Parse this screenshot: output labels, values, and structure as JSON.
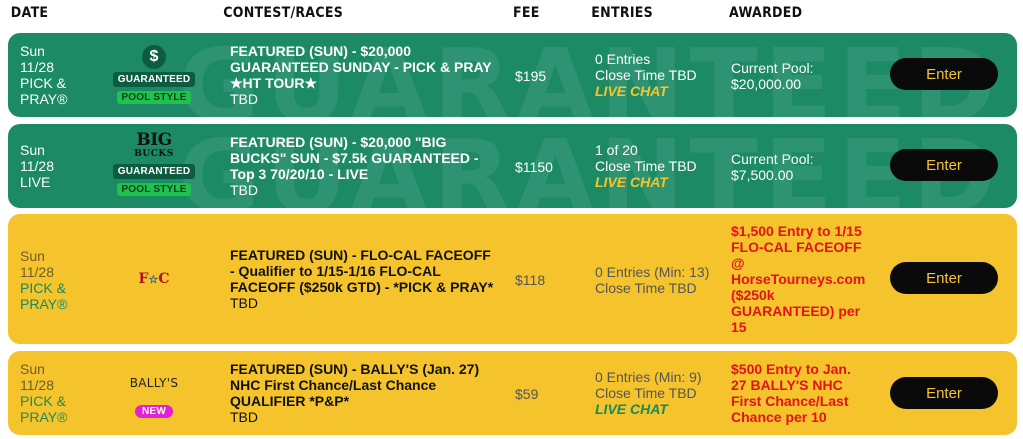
{
  "header": {
    "date": "DATE",
    "contest": "CONTEST/RACES",
    "fee": "FEE",
    "entries": "ENTRIES",
    "awarded": "AWARDED"
  },
  "watermark": "GUARANTEED",
  "rows": [
    {
      "date": [
        "Sun",
        "11/28",
        "PICK &",
        "PRAY®"
      ],
      "logo": "dollar-icon",
      "logo_text": "$",
      "badges": [
        "GUARANTEED",
        "POOL STYLE"
      ],
      "contest": [
        "FEATURED (SUN) - $20,000",
        "GUARANTEED SUNDAY - PICK & PRAY",
        "★HT TOUR★"
      ],
      "tbd": "TBD",
      "fee": "$195",
      "entries": [
        "0 Entries",
        "Close Time TBD"
      ],
      "live": "LIVE CHAT",
      "awarded": [
        "Current Pool:",
        "$20,000.00"
      ],
      "button": "Enter"
    },
    {
      "date": [
        "Sun",
        "11/28",
        "LIVE"
      ],
      "logo": "big-bucks-logo",
      "logo_text": [
        "BIG",
        "BUCKS"
      ],
      "badges": [
        "GUARANTEED",
        "POOL STYLE"
      ],
      "contest": [
        "FEATURED (SUN) - $20,000 \"BIG",
        "BUCKS\" SUN - $7.5k GUARANTEED -",
        "Top 3 70/20/10 - LIVE"
      ],
      "tbd": "TBD",
      "fee": "$1150",
      "entries": [
        "1 of 20",
        "Close Time TBD"
      ],
      "live": "LIVE CHAT",
      "awarded": [
        "Current Pool:",
        "$7,500.00"
      ],
      "button": "Enter"
    },
    {
      "date": [
        "Sun",
        "11/28",
        "PICK &",
        "PRAY®"
      ],
      "logo": "flo-cal-logo",
      "logo_text": [
        "F",
        "☆",
        "C"
      ],
      "contest": [
        "FEATURED (SUN) - FLO-CAL FACEOFF",
        "- Qualifier to 1/15-1/16 FLO-CAL",
        "FACEOFF ($250k GTD) - *PICK & PRAY*"
      ],
      "tbd": "TBD",
      "fee": "$118",
      "entries": [
        "0 Entries (Min: 13)",
        "Close Time TBD"
      ],
      "awarded": [
        "$1,500 Entry to 1/15",
        "FLO-CAL FACEOFF",
        "@",
        "HorseTourneys.com",
        "($250k",
        "GUARANTEED) per",
        "15"
      ],
      "button": "Enter"
    },
    {
      "date": [
        "Sun",
        "11/28",
        "PICK &",
        "PRAY®"
      ],
      "logo": "ballys-logo",
      "logo_text": "BALLY'S",
      "badges": [
        "NEW"
      ],
      "contest": [
        "FEATURED (SUN) - BALLY'S (Jan. 27)",
        "NHC First Chance/Last Chance",
        "QUALIFIER *P&P*"
      ],
      "tbd": "TBD",
      "fee": "$59",
      "entries": [
        "0 Entries (Min: 9)",
        "Close Time TBD"
      ],
      "live": "LIVE CHAT",
      "awarded": [
        "$500 Entry to Jan.",
        "27 BALLY'S NHC",
        "First Chance/Last",
        "Chance per 10"
      ],
      "button": "Enter"
    }
  ],
  "colors": {
    "green_row": "#1d8a66",
    "yellow_row": "#f5c32c",
    "live_chat_on_green": "#f6c52d",
    "live_chat_on_yellow": "#1a8a5a",
    "awarded_red": "#e3121b",
    "enter_button": "#0a0a0a",
    "enter_text": "#f6c52d"
  }
}
